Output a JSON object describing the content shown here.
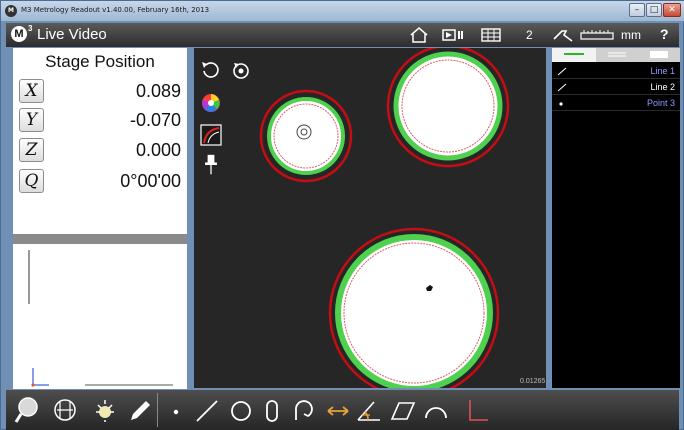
{
  "window": {
    "title": "M3 Metrology Readout  v1.40.00, February 16th, 2013",
    "icon_glyph": "M",
    "minimize_glyph": "–",
    "maximize_glyph": "□",
    "close_glyph": "✕"
  },
  "appbar": {
    "logo_glyph": "M",
    "logo_sup": "3",
    "title": "Live Video",
    "count": "2",
    "units": "mm",
    "help": "?",
    "icons": [
      "home-icon",
      "video-icon",
      "table-icon",
      "probe-icon",
      "ruler-icon"
    ]
  },
  "stage": {
    "title": "Stage Position",
    "axes": [
      {
        "key": "X",
        "value": "0.089"
      },
      {
        "key": "Y",
        "value": "-0.070"
      },
      {
        "key": "Z",
        "value": "0.000"
      },
      {
        "key": "Q",
        "value": "0°00'00"
      }
    ]
  },
  "video": {
    "scale_label": "0.01265",
    "tools": [
      "rotate-left-icon",
      "rotate-reset-icon",
      "color-wheel-icon",
      "edge-detect-icon",
      "pin-icon"
    ]
  },
  "features": {
    "tabs": [
      "line-tab",
      "list-tab",
      "blank-tab"
    ],
    "items": [
      {
        "label": "Line 1",
        "icon": "line-icon",
        "selected": true
      },
      {
        "label": "Line 2",
        "icon": "line-icon",
        "selected": false
      },
      {
        "label": "Point 3",
        "icon": "point-icon",
        "selected": false
      }
    ]
  },
  "bottom": {
    "left_tools": [
      "magnifier-icon",
      "crosshair-icon",
      "light-icon",
      "pencil-icon"
    ],
    "measure_tools": [
      "point-icon",
      "line-icon",
      "circle-icon",
      "slot-icon",
      "arc-contour-icon",
      "distance-icon",
      "angle-icon",
      "parallelogram-icon",
      "arc-icon",
      "origin-icon"
    ]
  },
  "colors": {
    "accent_selected": "#8f9bff",
    "green_tab": "#2bb52b",
    "fit_circle": "#c40d14"
  }
}
